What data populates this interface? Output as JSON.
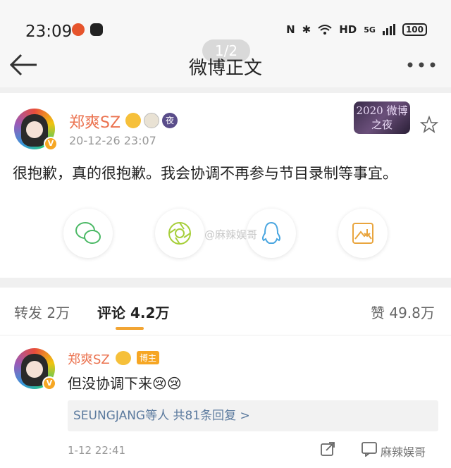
{
  "status_bar": {
    "time": "23:09",
    "network": "HD",
    "signal": "5G",
    "battery": "100"
  },
  "nav": {
    "title": "微博正文",
    "page_indicator": "1/2"
  },
  "post": {
    "username": "郑爽SZ",
    "night_badge": "夜",
    "timestamp": "20-12-26 23:07",
    "text": "很抱歉，真的很抱歉。我会协调不再参与节目录制等事宜。",
    "event_logo_text": "2020 微博之夜",
    "share_buttons": [
      "wechat-icon",
      "moments-icon",
      "qq-icon",
      "save-image-icon"
    ],
    "watermark": "@麻辣娱哥"
  },
  "tabs": {
    "repost_label": "转发",
    "repost_count": "2万",
    "comment_label": "评论",
    "comment_count": "4.2万",
    "like_label": "赞",
    "like_count": "49.8万"
  },
  "comment": {
    "username": "郑爽SZ",
    "host_badge": "博主",
    "text": "但没协调下来😢😢",
    "reply_summary": "SEUNGJANG等人  共81条回复  >",
    "timestamp": "1-12 22:41",
    "watermark": "麻辣娱哥"
  },
  "colors": {
    "accent_orange": "#f2a534",
    "username": "#eb7350",
    "link_blue": "#5b7a9e"
  }
}
